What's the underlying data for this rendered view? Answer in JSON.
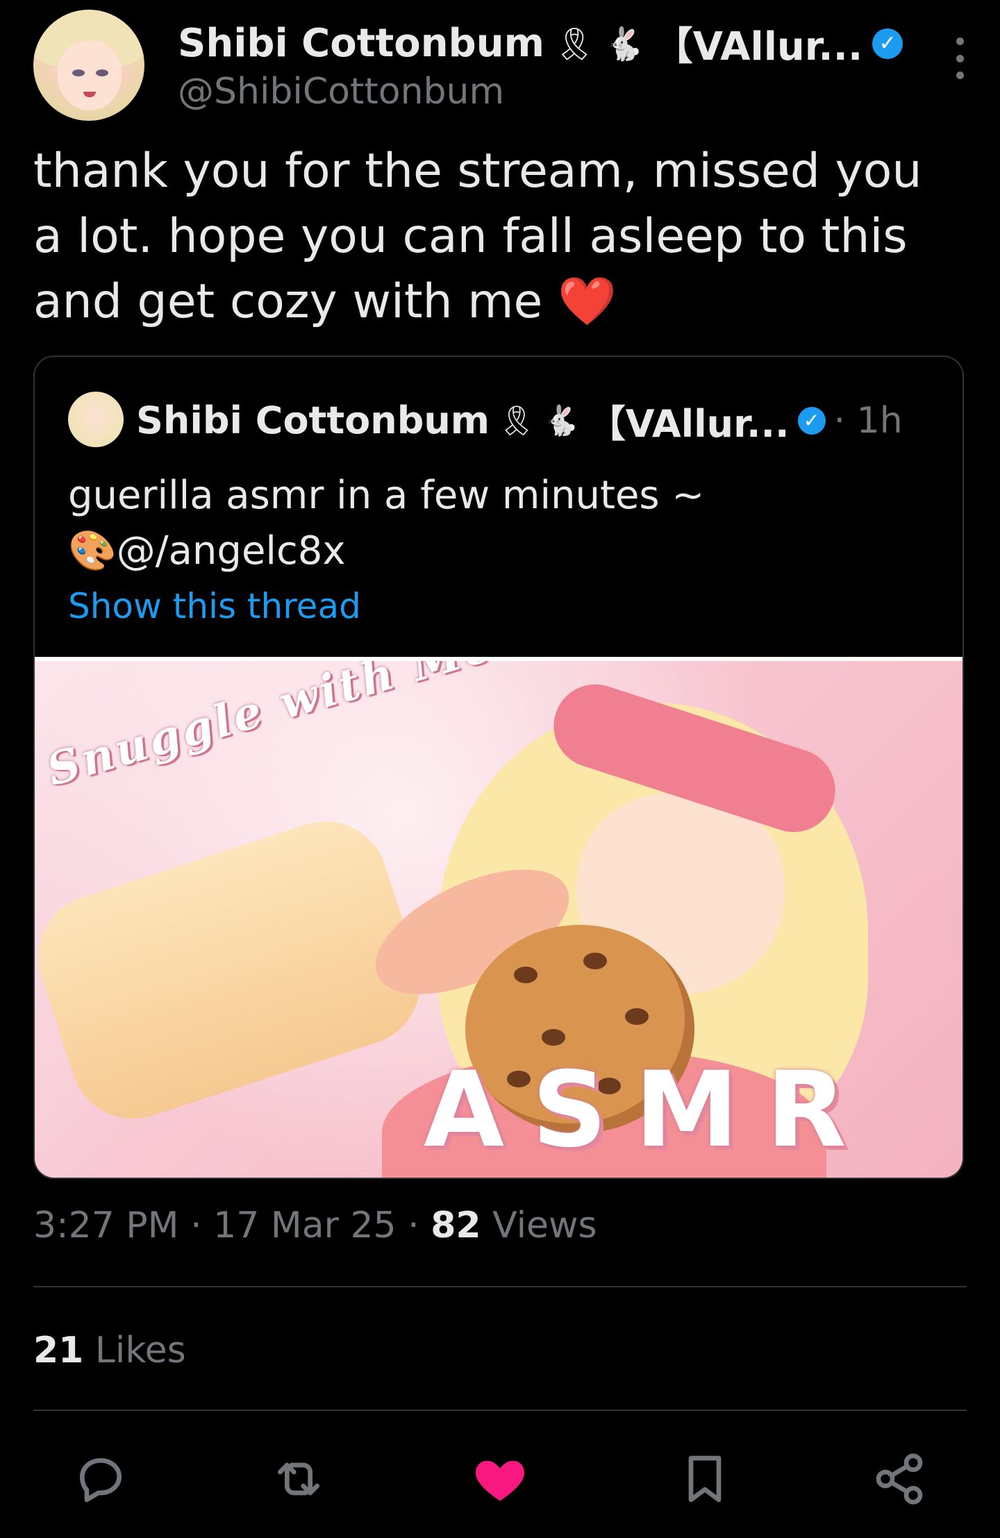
{
  "post": {
    "author": {
      "display_name": "Shibi Cottonbum",
      "badge_emojis": [
        "🎗",
        "🐇"
      ],
      "name_suffix": "【VAllur...",
      "handle": "@ShibiCottonbum",
      "verified": true
    },
    "text": "thank you for the stream, missed you a lot. hope you can fall asleep to this and get cozy with me",
    "text_emoji": "❤️",
    "quoted": {
      "display_name": "Shibi Cottonbum",
      "badge_emojis": [
        "🎗",
        "🐇"
      ],
      "name_suffix": "【VAllur...",
      "time": "· 1h",
      "text_line1": "guerilla asmr in a few minutes ~",
      "text_line2": "🎨@/angelc8x",
      "show_thread": "Show this thread",
      "image": {
        "title": "Snuggle with Me",
        "subtitle": "ASMR"
      }
    },
    "meta": {
      "time": "3:27 PM",
      "date": "17 Mar 25",
      "views_count": "82",
      "views_label": "Views",
      "sep": "·"
    },
    "likes": {
      "count": "21",
      "label": "Likes"
    }
  },
  "actions": [
    {
      "icon": "reply-icon"
    },
    {
      "icon": "repost-icon"
    },
    {
      "icon": "like-icon",
      "active": true,
      "color": "#f91880"
    },
    {
      "icon": "bookmark-icon"
    },
    {
      "icon": "share-icon"
    }
  ],
  "colors": {
    "background": "#000000",
    "text": "#e7e9ea",
    "muted": "#71767b",
    "accent": "#1d9bf0",
    "like": "#f91880"
  }
}
